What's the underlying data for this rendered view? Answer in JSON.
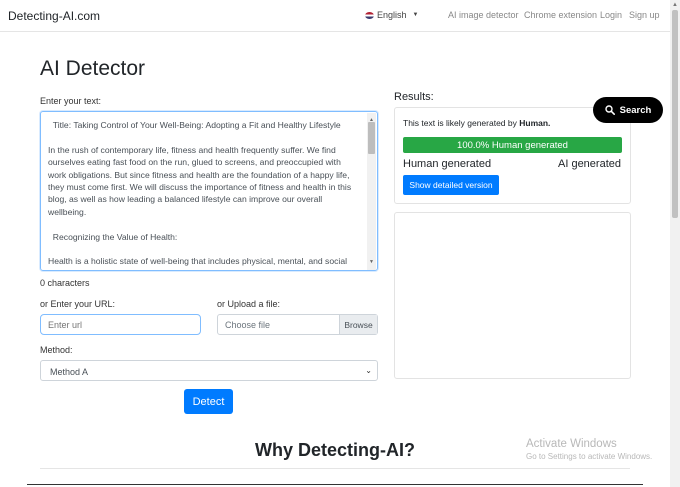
{
  "navbar": {
    "brand": "Detecting-AI.com",
    "language": "English",
    "links": [
      "AI image detector",
      "Chrome extension",
      "Login",
      "Sign up"
    ]
  },
  "main": {
    "title": "AI Detector",
    "text_label": "Enter your text:",
    "text_paragraphs": [
      "  Title: Taking Control of Your Well-Being: Adopting a Fit and Healthy Lifestyle",
      "In the rush of contemporary life, fitness and health frequently suffer. We find ourselves eating fast food on the run, glued to screens, and preoccupied with work obligations. But since fitness and health are the foundation of a happy life, they must come first. We will discuss the importance of fitness and health in this blog, as well as how leading a balanced lifestyle can improve our overall wellbeing.",
      "  Recognizing the Value of Health:",
      "Health is a holistic state of well-being that includes physical, mental, and social dimensions and goes beyond simply being free of disease. Being in good physical"
    ],
    "char_count": "0 characters",
    "url_label": "or Enter your URL:",
    "url_placeholder": "Enter url",
    "upload_label": "or Upload a file:",
    "file_placeholder": "Choose file",
    "browse_label": "Browse",
    "method_label": "Method:",
    "method_selected": "Method A",
    "detect_label": "Detect"
  },
  "results": {
    "label": "Results:",
    "likely_prefix": "This text is likely generated by ",
    "likely_value": "Human.",
    "progress_percent": 100.0,
    "progress_label": "100.0% Human generated",
    "human_label": "Human generated",
    "ai_label": "AI generated",
    "detail_button": "Show detailed version"
  },
  "search_button": "Search",
  "why_title": "Why Detecting-AI?",
  "watermark": {
    "line1": "Activate Windows",
    "line2": "Go to Settings to activate Windows."
  },
  "colors": {
    "primary": "#007bff",
    "success": "#28a745"
  }
}
